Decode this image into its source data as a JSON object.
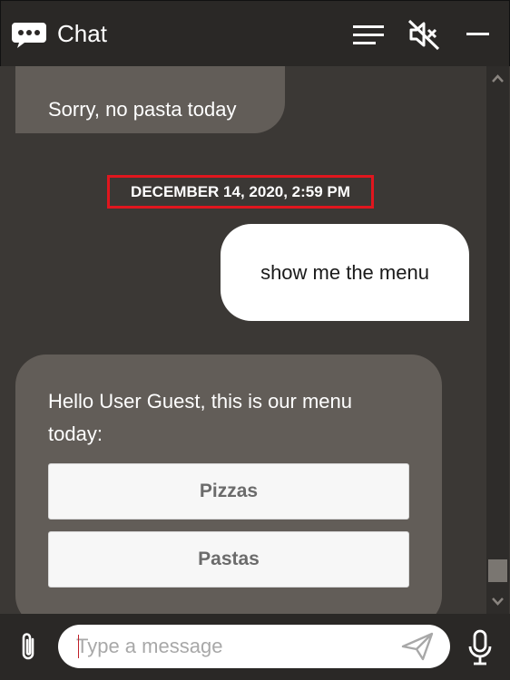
{
  "header": {
    "title": "Chat"
  },
  "messages": [
    {
      "from": "bot",
      "text": "Sorry, no pasta today"
    },
    {
      "from": "user",
      "text": "show me the menu"
    },
    {
      "from": "bot",
      "text": "Hello User Guest, this is our menu today:"
    }
  ],
  "timestamp": "DECEMBER 14, 2020, 2:59 PM",
  "menu_choices": [
    "Pizzas",
    "Pastas"
  ],
  "composer": {
    "placeholder": "Type a message"
  },
  "colors": {
    "header_bg": "#2a2826",
    "conversation_bg": "#3b3835",
    "bot_bubble": "#625d58",
    "user_bubble": "#ffffff",
    "timestamp_highlight": "#e0161e"
  },
  "icons": [
    "chat-bubble-icon",
    "hamburger-menu-icon",
    "speaker-muted-icon",
    "minimize-icon",
    "paperclip-icon",
    "send-icon",
    "microphone-icon",
    "scroll-up-arrow-icon",
    "scroll-down-arrow-icon"
  ]
}
